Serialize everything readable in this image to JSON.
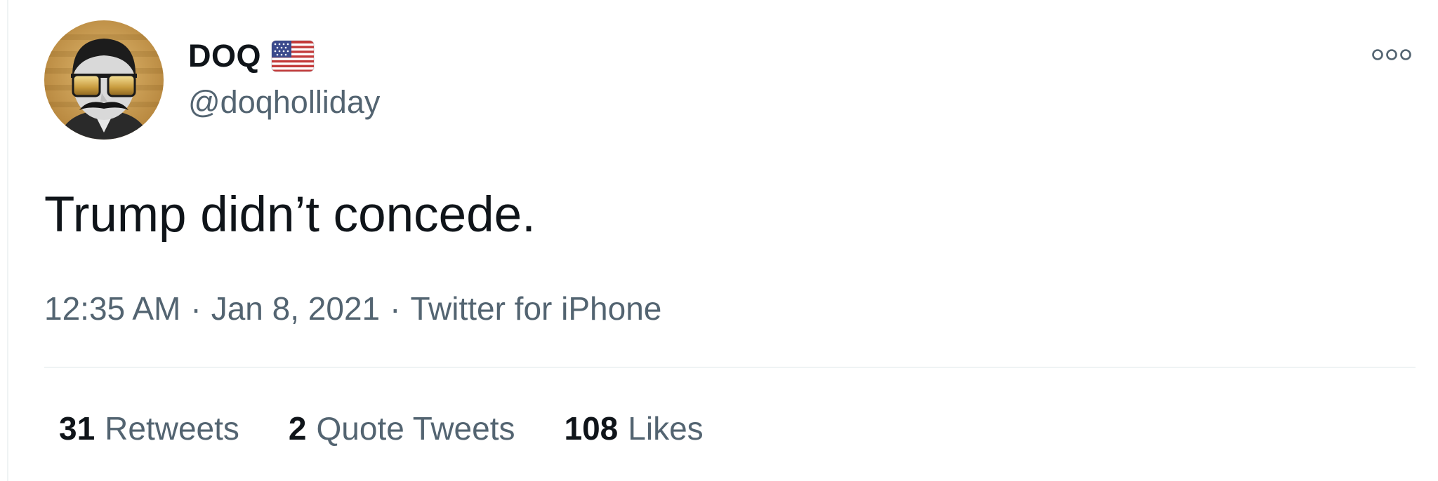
{
  "author": {
    "display_name": "DOQ",
    "handle": "@doqholliday",
    "badge_icon": "us-flag-icon",
    "avatar_icon": "profile-avatar-mustache-sunglasses"
  },
  "more_icon": "more-options-icon",
  "tweet": {
    "text": "Trump didn’t concede.",
    "time": "12:35 AM",
    "date": "Jan 8, 2021",
    "source": "Twitter for iPhone",
    "separator": "·"
  },
  "stats": {
    "retweets": {
      "count": "31",
      "label": "Retweets"
    },
    "quote_tweets": {
      "count": "2",
      "label": "Quote Tweets"
    },
    "likes": {
      "count": "108",
      "label": "Likes"
    }
  },
  "colors": {
    "text_primary": "#0f1419",
    "text_secondary": "#536471",
    "divider": "#eff3f4",
    "avatar_gold": "#c89a4b"
  }
}
